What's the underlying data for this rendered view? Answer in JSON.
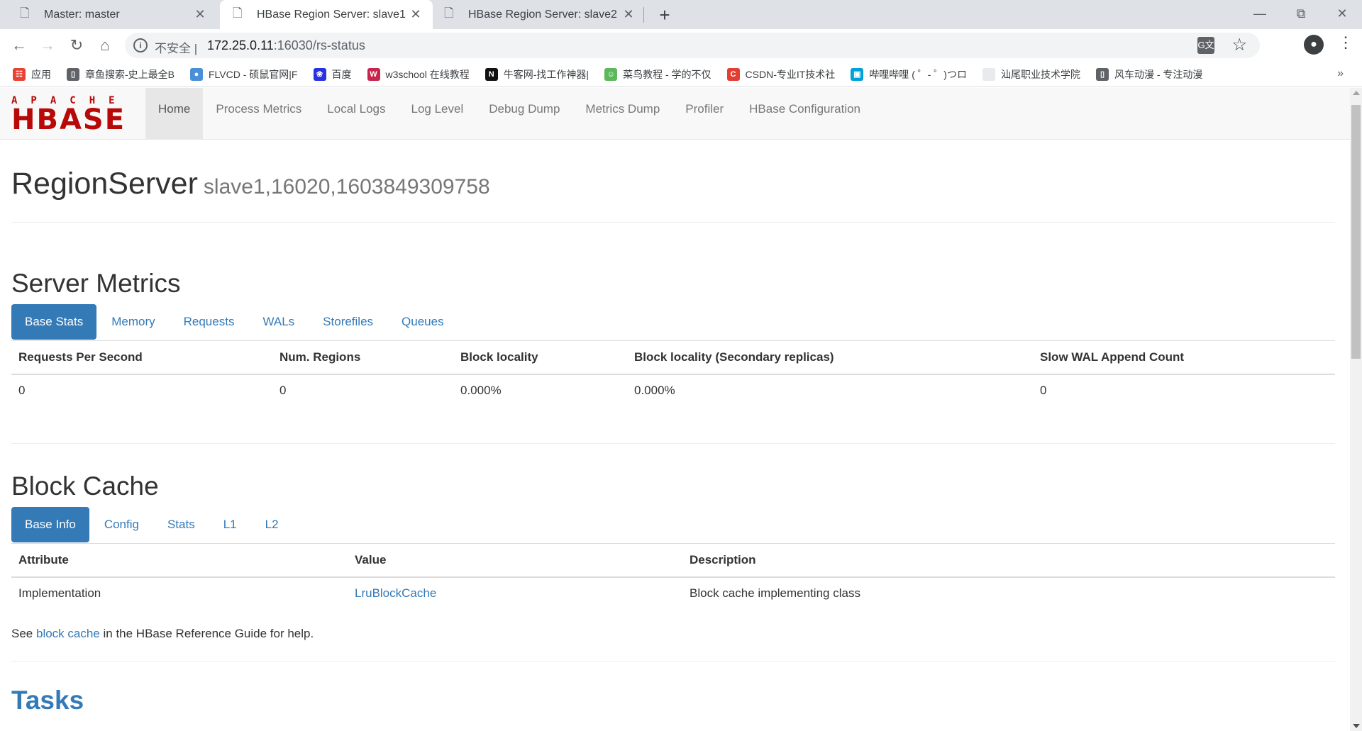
{
  "browser": {
    "tabs": [
      {
        "title": "Master: master",
        "active": false
      },
      {
        "title": "HBase Region Server: slave1",
        "active": true
      },
      {
        "title": "HBase Region Server: slave2",
        "active": false
      }
    ],
    "security_label": "不安全",
    "url_host": "172.25.0.11",
    "url_path": ":16030/rs-status",
    "bookmarks": [
      {
        "label": "应用",
        "icon": "apps-grid-icon",
        "color": "#e94235"
      },
      {
        "label": "章鱼搜索-史上最全B",
        "icon": "page-icon",
        "color": "#5f6368"
      },
      {
        "label": "FLVCD - 硕鼠官网|F",
        "icon": "globe-icon",
        "color": "#4a90d9"
      },
      {
        "label": "百度",
        "icon": "baidu-paw-icon",
        "color": "#2932e1"
      },
      {
        "label": "w3school 在线教程",
        "icon": "w3school-icon",
        "color": "#c7254e"
      },
      {
        "label": "牛客网-找工作神器|",
        "icon": "nowcoder-icon",
        "color": "#111111"
      },
      {
        "label": "菜鸟教程 - 学的不仅",
        "icon": "runoob-icon",
        "color": "#5cb85c"
      },
      {
        "label": "CSDN-专业IT技术社",
        "icon": "csdn-icon",
        "color": "#e33e33"
      },
      {
        "label": "哔哩哔哩 ( ゜- ゜)つロ",
        "icon": "bilibili-icon",
        "color": "#00a1d6"
      },
      {
        "label": "汕尾职业技术学院",
        "icon": "blank-icon",
        "color": "#e8eaed"
      },
      {
        "label": "风车动漫 - 专注动漫",
        "icon": "page-icon",
        "color": "#5f6368"
      }
    ]
  },
  "navbar": {
    "logo_top": "APACHE",
    "logo_main": "HBASE",
    "links": [
      "Home",
      "Process Metrics",
      "Local Logs",
      "Log Level",
      "Debug Dump",
      "Metrics Dump",
      "Profiler",
      "HBase Configuration"
    ]
  },
  "header": {
    "title": "RegionServer",
    "subtitle": "slave1,16020,1603849309758"
  },
  "server_metrics": {
    "title": "Server Metrics",
    "tabs": [
      "Base Stats",
      "Memory",
      "Requests",
      "WALs",
      "Storefiles",
      "Queues"
    ],
    "columns": [
      "Requests Per Second",
      "Num. Regions",
      "Block locality",
      "Block locality (Secondary replicas)",
      "Slow WAL Append Count"
    ],
    "row": [
      "0",
      "0",
      "0.000%",
      "0.000%",
      "0"
    ]
  },
  "block_cache": {
    "title": "Block Cache",
    "tabs": [
      "Base Info",
      "Config",
      "Stats",
      "L1",
      "L2"
    ],
    "columns": [
      "Attribute",
      "Value",
      "Description"
    ],
    "row": [
      "Implementation",
      "LruBlockCache",
      "Block cache implementing class"
    ],
    "help_prefix": "See ",
    "help_link": "block cache",
    "help_suffix": " in the HBase Reference Guide for help."
  },
  "tasks": {
    "title": "Tasks"
  }
}
